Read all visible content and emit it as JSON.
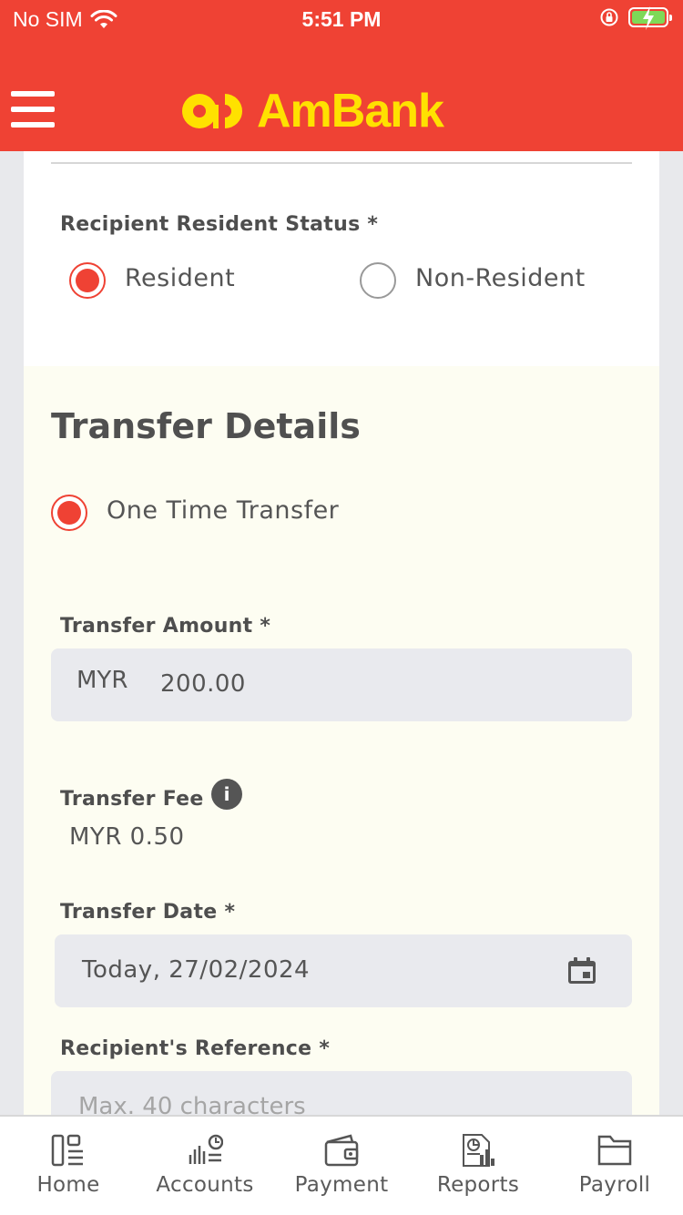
{
  "status_bar": {
    "carrier": "No SIM",
    "time": "5:51 PM"
  },
  "header": {
    "brand": "AmBank",
    "brand_color": "#ffe100",
    "accent_color": "#ef4234"
  },
  "recipient_status": {
    "label": "Recipient Resident Status *",
    "options": [
      "Resident",
      "Non-Resident"
    ],
    "selected": "Resident"
  },
  "transfer_details": {
    "title": "Transfer Details",
    "transfer_type": "One Time Transfer",
    "amount_label": "Transfer Amount *",
    "amount_currency": "MYR",
    "amount_value": "200.00",
    "fee_label": "Transfer Fee",
    "fee_value": "MYR 0.50",
    "date_label": "Transfer Date *",
    "date_value": "Today, 27/02/2024",
    "reference_label": "Recipient's Reference *",
    "reference_placeholder": "Max. 40 characters"
  },
  "tabbar": {
    "items": [
      "Home",
      "Accounts",
      "Payment",
      "Reports",
      "Payroll"
    ]
  }
}
